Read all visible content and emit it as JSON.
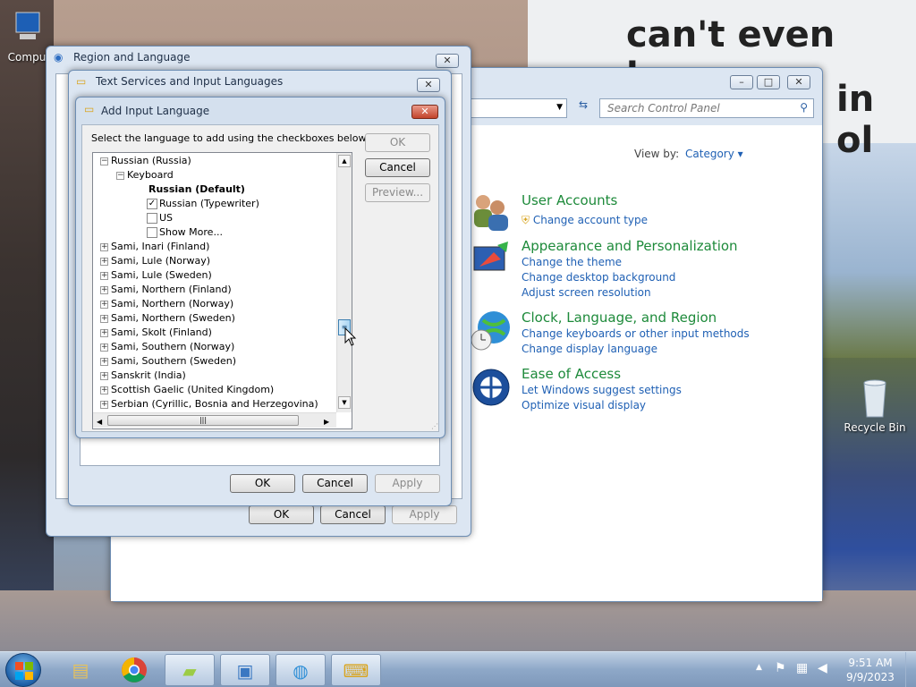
{
  "wallpaper": {
    "line1": "can't even have",
    "line2": "in ol"
  },
  "desktop": {
    "computer_label": "Compu",
    "recycle_bin_label": "Recycle Bin"
  },
  "control_panel": {
    "search_placeholder": "Search Control Panel",
    "view_by_label": "View by:",
    "view_by_value": "Category",
    "categories": [
      {
        "title": "User Accounts",
        "links": [
          "Change account type"
        ]
      },
      {
        "title": "Appearance and Personalization",
        "links": [
          "Change the theme",
          "Change desktop background",
          "Adjust screen resolution"
        ]
      },
      {
        "title": "Clock, Language, and Region",
        "links": [
          "Change keyboards or other input methods",
          "Change display language"
        ]
      },
      {
        "title": "Ease of Access",
        "links": [
          "Let Windows suggest settings",
          "Optimize visual display"
        ]
      }
    ]
  },
  "region_dialog": {
    "title": "Region and Language",
    "ok": "OK",
    "cancel": "Cancel",
    "apply": "Apply"
  },
  "text_services_dialog": {
    "title": "Text Services and Input Languages",
    "ok": "OK",
    "cancel": "Cancel",
    "apply": "Apply"
  },
  "add_input_dialog": {
    "title": "Add Input Language",
    "instruction": "Select the language to add using the checkboxes below.",
    "ok": "OK",
    "cancel": "Cancel",
    "preview": "Preview...",
    "tree": {
      "russia": "Russian (Russia)",
      "keyboard": "Keyboard",
      "default": "Russian (Default)",
      "typewriter": "Russian (Typewriter)",
      "us": "US",
      "show_more": "Show More...",
      "languages": [
        "Sami, Inari (Finland)",
        "Sami, Lule (Norway)",
        "Sami, Lule (Sweden)",
        "Sami, Northern (Finland)",
        "Sami, Northern (Norway)",
        "Sami, Northern (Sweden)",
        "Sami, Skolt (Finland)",
        "Sami, Southern (Norway)",
        "Sami, Southern (Sweden)",
        "Sanskrit (India)",
        "Scottish Gaelic (United Kingdom)",
        "Serbian (Cyrillic, Bosnia and Herzegovina)"
      ]
    }
  },
  "taskbar": {
    "time": "9:51 AM",
    "date": "9/9/2023"
  }
}
